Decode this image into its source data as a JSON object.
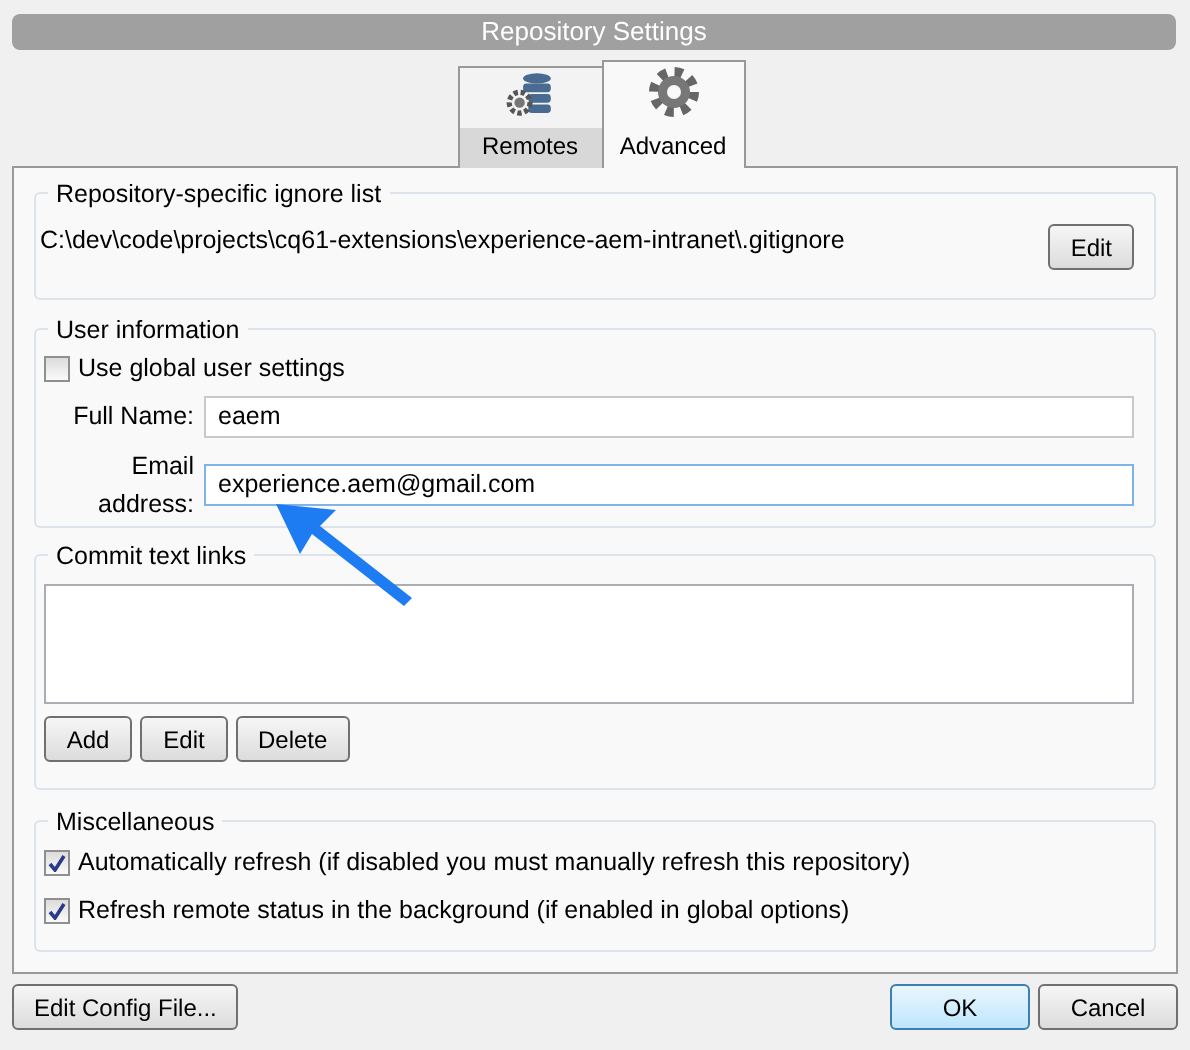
{
  "window": {
    "title": "Repository Settings"
  },
  "tabs": [
    {
      "label": "Remotes",
      "kind": "remotes",
      "selected": false
    },
    {
      "label": "Advanced",
      "kind": "advanced",
      "selected": true
    }
  ],
  "ignore_list": {
    "title": "Repository-specific ignore list",
    "path": "C:\\dev\\code\\projects\\cq61-extensions\\experience-aem-intranet\\.gitignore",
    "button": "Edit"
  },
  "user_information": {
    "title": "User information",
    "use_global": {
      "label": "Use global user settings",
      "checked": false
    },
    "fields": [
      {
        "label": "Full Name:",
        "value": "eaem",
        "focused": false
      },
      {
        "label": "Email address:",
        "value": "experience.aem@gmail.com",
        "focused": true
      }
    ]
  },
  "commit_text_links": {
    "title": "Commit text links",
    "buttons": [
      "Add",
      "Edit",
      "Delete"
    ]
  },
  "miscellaneous": {
    "title": "Miscellaneous",
    "options": [
      {
        "label": "Automatically refresh (if disabled you must manually refresh this repository)",
        "checked": true
      },
      {
        "label": "Refresh remote status in the background (if enabled in global options)",
        "checked": true
      }
    ]
  },
  "footer": {
    "left": [
      {
        "label": "Edit Config File...",
        "default": false
      }
    ],
    "right": [
      {
        "label": "OK",
        "default": true
      },
      {
        "label": "Cancel",
        "default": false
      }
    ]
  }
}
